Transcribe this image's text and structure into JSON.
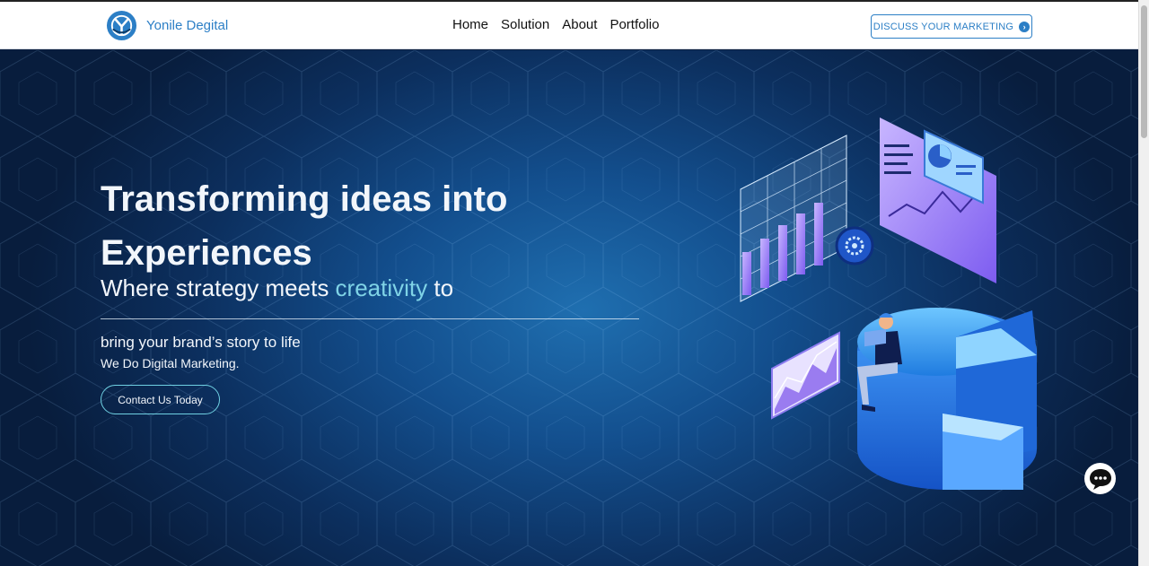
{
  "brand": {
    "name": "Yonile Degital",
    "logo_icon": "yd-logo-icon"
  },
  "nav": {
    "items": [
      "Home",
      "Solution",
      "About",
      "Portfolio"
    ]
  },
  "header_cta": {
    "label": "DISCUSS YOUR MARKETING",
    "icon": "arrow-right-circle-icon"
  },
  "hero": {
    "headline": "Transforming ideas into Experiences",
    "tagline_prefix": "Where strategy meets ",
    "tagline_accent": "creativity",
    "tagline_suffix": " to",
    "sub_line_1": "bring your brand’s story to life",
    "sub_line_2": "We Do Digital Marketing.",
    "button_label": "Contact Us Today",
    "illustration": "isometric-analytics-illustration"
  },
  "chat": {
    "icon": "chat-bubble-icon"
  },
  "colors": {
    "accent": "#2c7fc6",
    "highlight": "#7fd3e6",
    "hero_dark": "#081d3d",
    "hero_light": "#1f6fb0"
  }
}
